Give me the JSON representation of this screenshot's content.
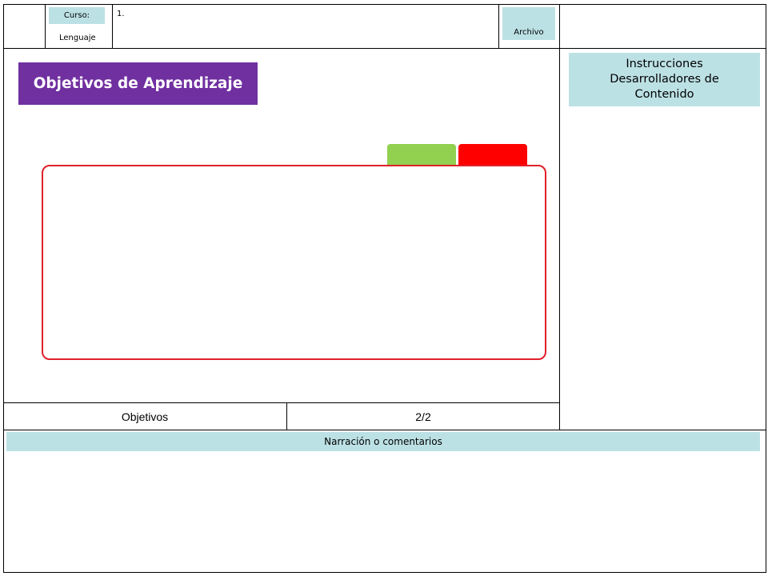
{
  "header": {
    "curso_label": "Curso:",
    "lenguaje_label": "Lenguaje",
    "title_text": "1.",
    "archivo_label": "Archivo"
  },
  "slide": {
    "heading": "Objetivos de Aprendizaje",
    "footer_section": "Objetivos",
    "footer_page": "2/2"
  },
  "side": {
    "instructions_title": "Instrucciones Desarrolladores de Contenido"
  },
  "narration": {
    "label": "Narración o comentarios"
  },
  "colors": {
    "heading_bg": "#7030a0",
    "label_bg": "#bce1e5",
    "green_button": "#92d050",
    "red_button": "#ff0000",
    "content_border": "#e0202a"
  }
}
